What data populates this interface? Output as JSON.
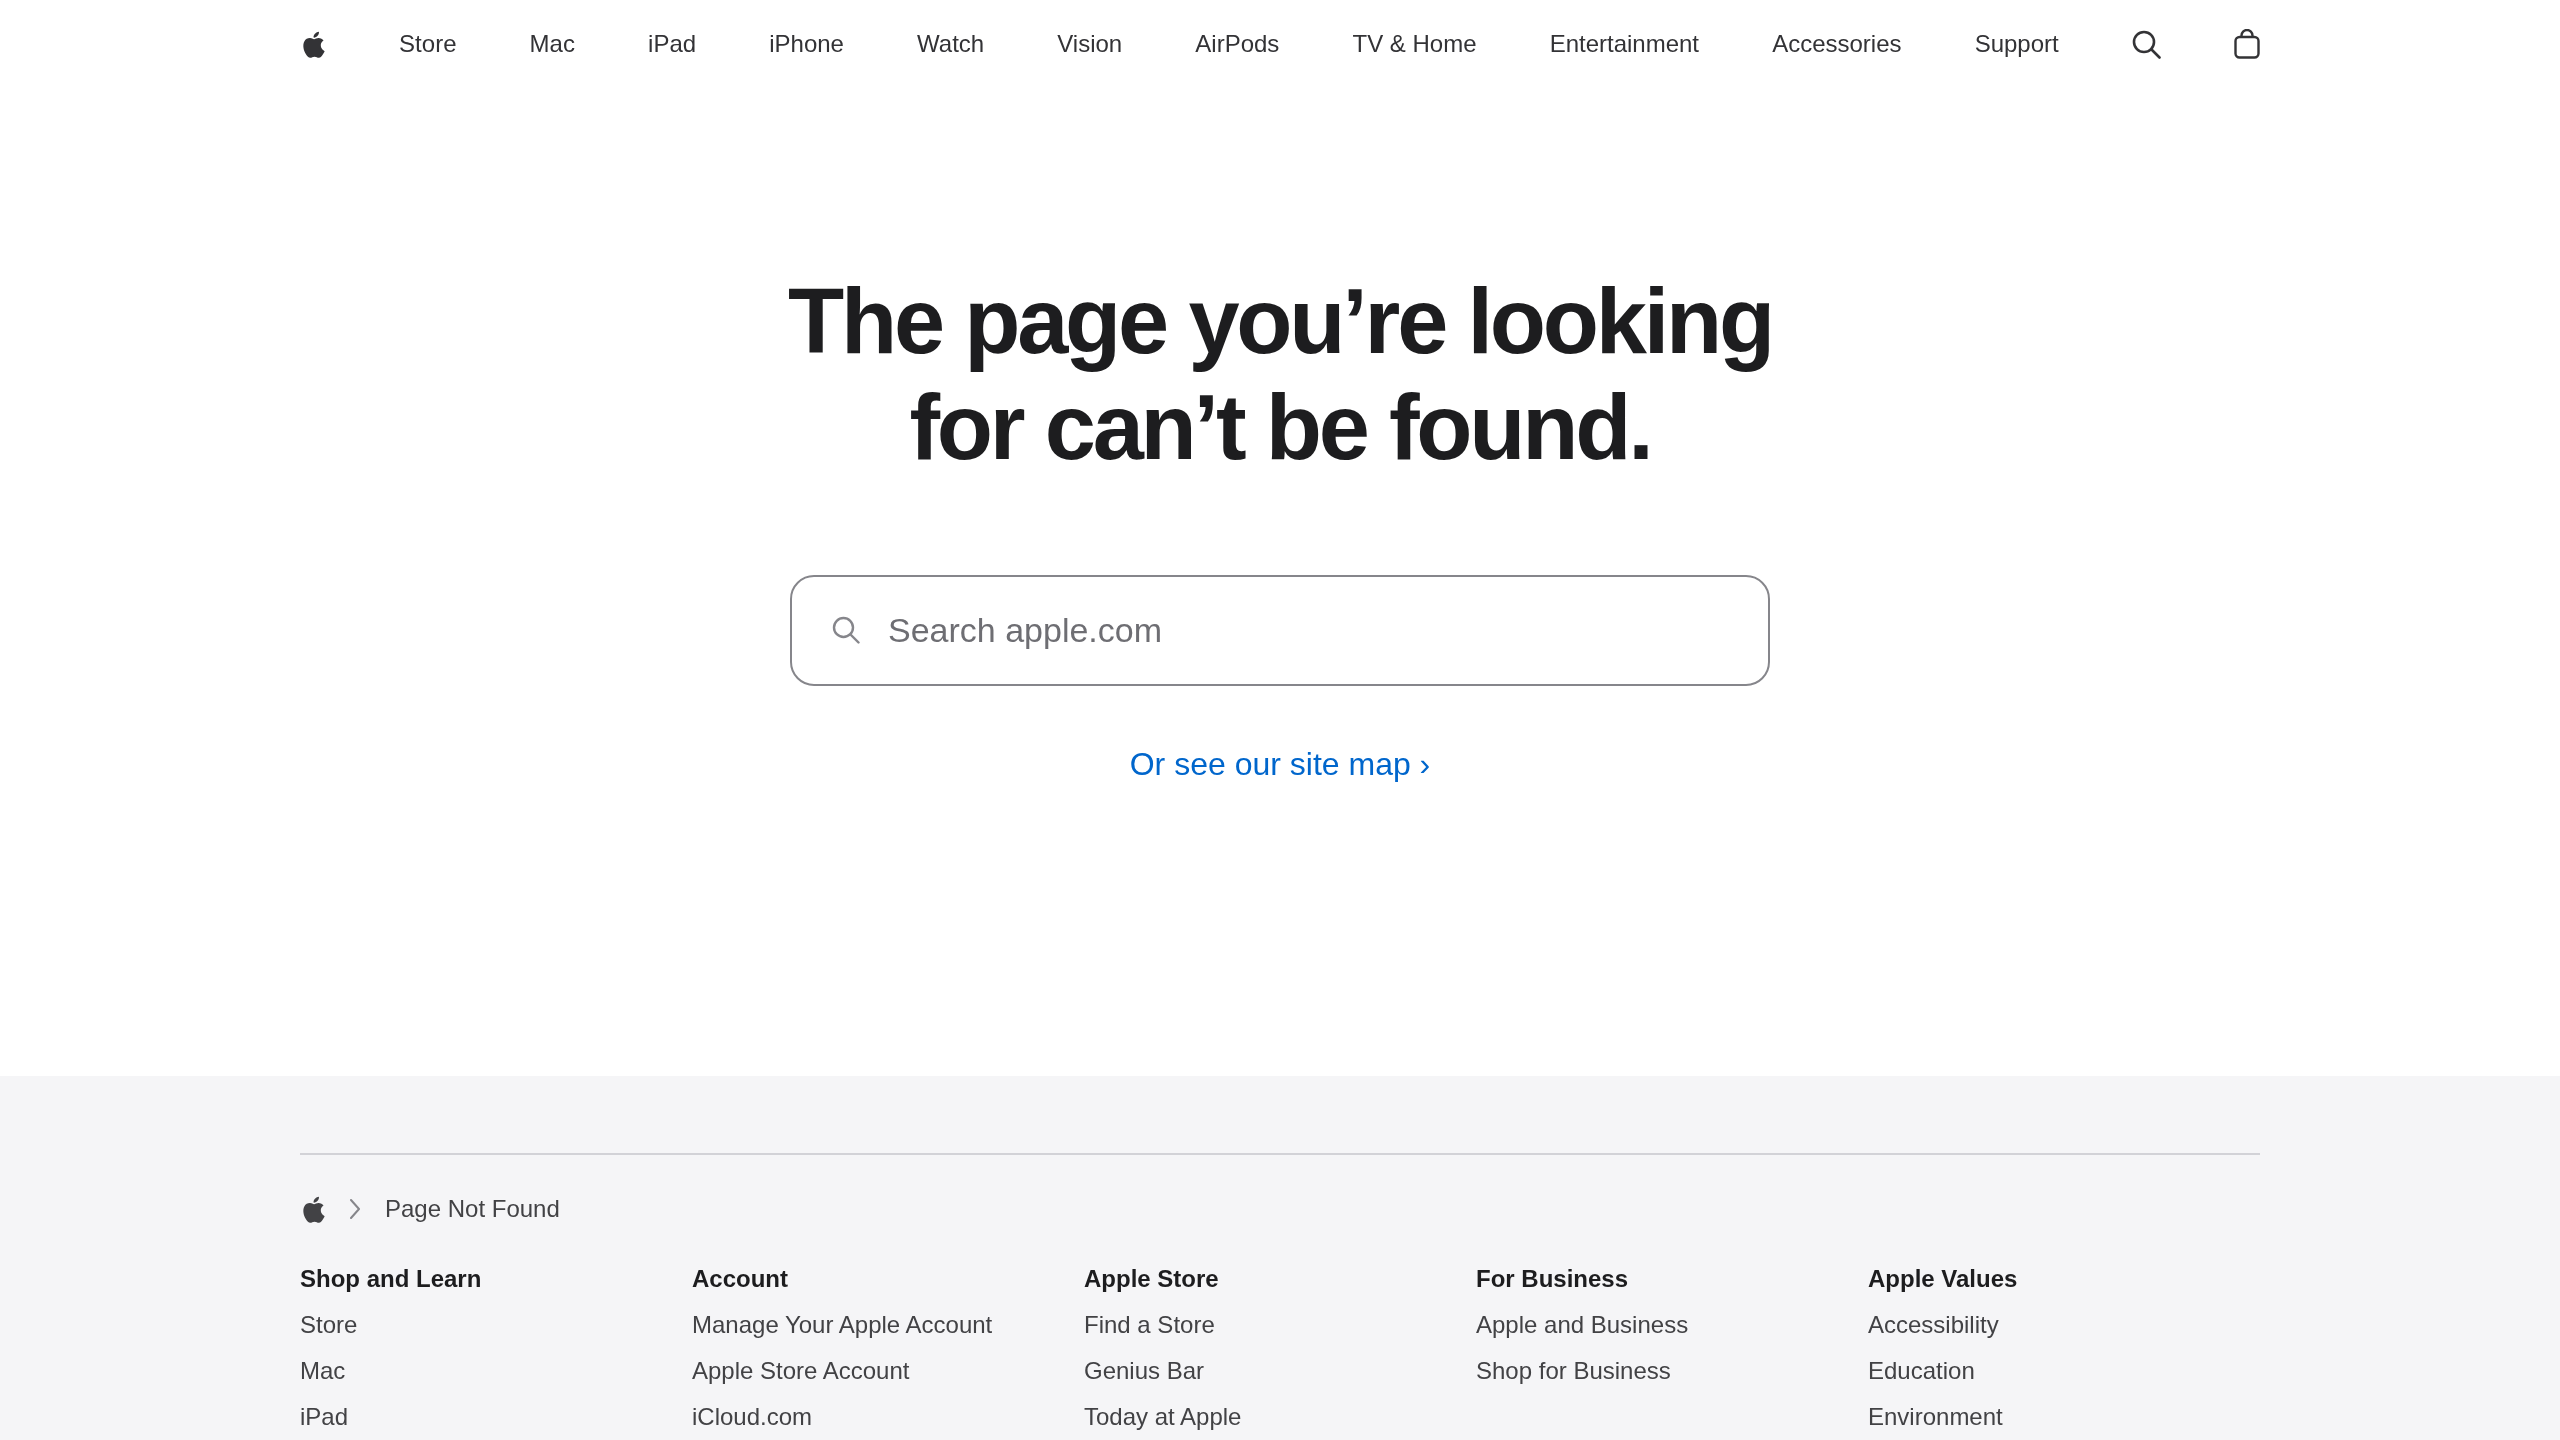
{
  "nav": {
    "items": [
      "Store",
      "Mac",
      "iPad",
      "iPhone",
      "Watch",
      "Vision",
      "AirPods",
      "TV & Home",
      "Entertainment",
      "Accessories",
      "Support"
    ]
  },
  "headline": "The page you’re looking for can’t be found.",
  "search": {
    "placeholder": "Search apple.com"
  },
  "sitemap_link": "Or see our site map ›",
  "breadcrumb": {
    "current": "Page Not Found"
  },
  "footer": {
    "columns": [
      {
        "heading": "Shop and Learn",
        "links": [
          "Store",
          "Mac",
          "iPad"
        ]
      },
      {
        "heading": "Account",
        "links": [
          "Manage Your Apple Account",
          "Apple Store Account",
          "iCloud.com"
        ]
      },
      {
        "heading": "Apple Store",
        "links": [
          "Find a Store",
          "Genius Bar",
          "Today at Apple"
        ]
      },
      {
        "heading": "For Business",
        "links": [
          "Apple and Business",
          "Shop for Business"
        ]
      },
      {
        "heading": "Apple Values",
        "links": [
          "Accessibility",
          "Education",
          "Environment"
        ]
      }
    ]
  }
}
